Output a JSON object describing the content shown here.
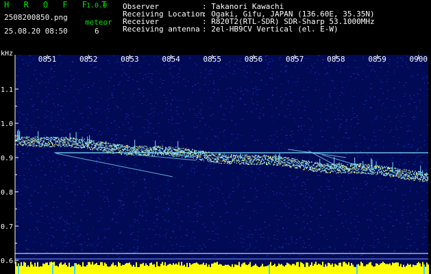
{
  "header": {
    "app_title": "H R O F F T",
    "app_version": "1.0.0",
    "file_name": "2508200850.png",
    "date_time": "25.08.20 08:50",
    "meteor_label": "meteor",
    "meteor_count": "6"
  },
  "info": [
    {
      "key": "Observer",
      "value": ": Takanori Kawachi"
    },
    {
      "key": "Receiving Location",
      "value": ": Ogaki, Gifu, JAPAN (136.60E, 35.35N)"
    },
    {
      "key": "Receiver",
      "value": ": R820T2(RTL-SDR) SDR-Sharp 53.1000MHz"
    },
    {
      "key": "Receiving antenna",
      "value": ": 2el-HB9CV Vertical (el. E-W)"
    }
  ],
  "spectrogram": {
    "unit": "kHz",
    "time_labels": [
      "0851",
      "0852",
      "0853",
      "0854",
      "0855",
      "0856",
      "0857",
      "0858",
      "0859",
      "0900"
    ],
    "freq_labels": [
      "1.1",
      "1.0",
      "0.9",
      "0.8",
      "0.7",
      "0.6"
    ],
    "colors": {
      "background": "#000a55",
      "noise": "#1a3cc8",
      "signal": "#7ee6ff",
      "trail": "#ffff80",
      "grid": "#ffffff",
      "power": "#ffff00"
    }
  }
}
